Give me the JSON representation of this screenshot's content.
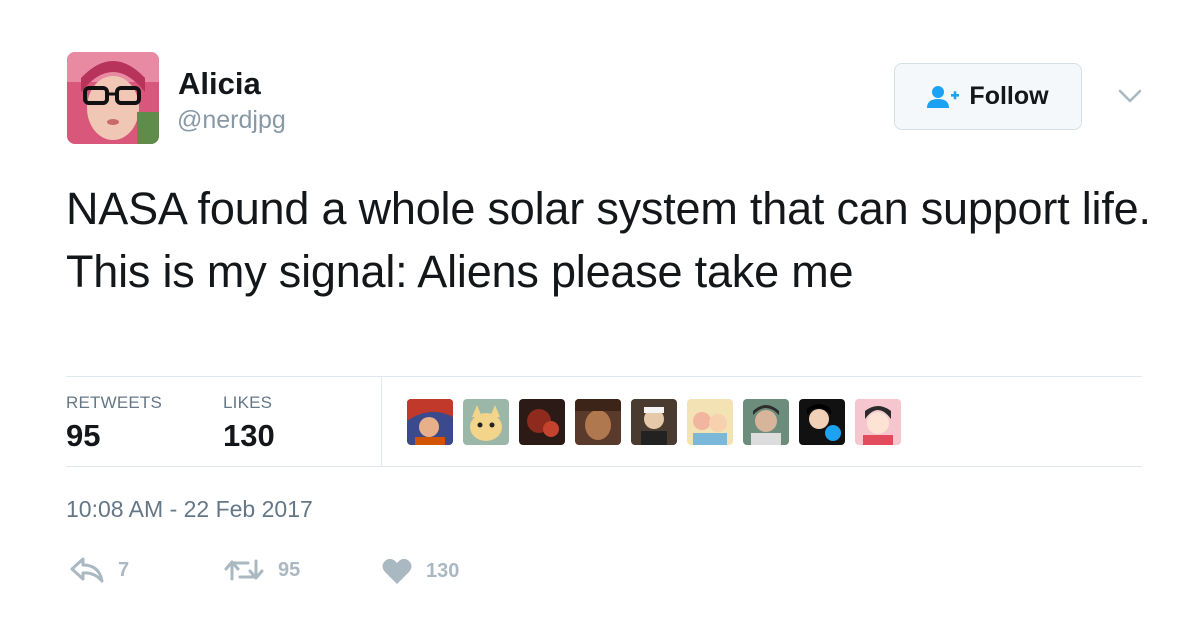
{
  "user": {
    "display_name": "Alicia",
    "handle": "@nerdjpg",
    "avatar_icon": "avatar-photo"
  },
  "follow_button": {
    "label": "Follow",
    "icon": "add-user-icon"
  },
  "menu_icon": "chevron-down-icon",
  "tweet": {
    "text": "NASA found a whole solar system that can support life. This is my signal: Aliens please take me"
  },
  "stats": {
    "retweets_label": "RETWEETS",
    "retweets_value": "95",
    "likes_label": "LIKES",
    "likes_value": "130"
  },
  "likers": [
    {
      "icon": "liker-avatar-1"
    },
    {
      "icon": "liker-avatar-2"
    },
    {
      "icon": "liker-avatar-3"
    },
    {
      "icon": "liker-avatar-4"
    },
    {
      "icon": "liker-avatar-5"
    },
    {
      "icon": "liker-avatar-6"
    },
    {
      "icon": "liker-avatar-7"
    },
    {
      "icon": "liker-avatar-8"
    },
    {
      "icon": "liker-avatar-9"
    }
  ],
  "timestamp": "10:08 AM - 22 Feb 2017",
  "actions": {
    "reply_count": "7",
    "retweet_count": "95",
    "like_count": "130"
  },
  "colors": {
    "accent": "#1da1f2",
    "text": "#14171a",
    "muted": "#657786",
    "icon_gray": "#aab8c2",
    "divider": "#e1e8ed"
  }
}
